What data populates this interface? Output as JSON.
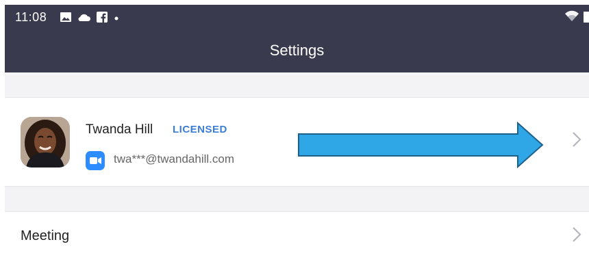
{
  "status_bar": {
    "time": "11:08",
    "icons": [
      "image-icon",
      "cloud-icon",
      "facebook-icon",
      "dot-icon"
    ],
    "right_icons": [
      "wifi-icon",
      "battery-icon"
    ]
  },
  "header": {
    "title": "Settings"
  },
  "profile": {
    "name": "Twanda Hill",
    "license_badge": "LICENSED",
    "email": "twa***@twandahill.com",
    "brand_color": "#2d8cff",
    "badge_color": "#3a7dd6"
  },
  "annotation": {
    "arrow_color": "#2fa6e6"
  },
  "settings_items": [
    {
      "label": "Meeting"
    }
  ]
}
